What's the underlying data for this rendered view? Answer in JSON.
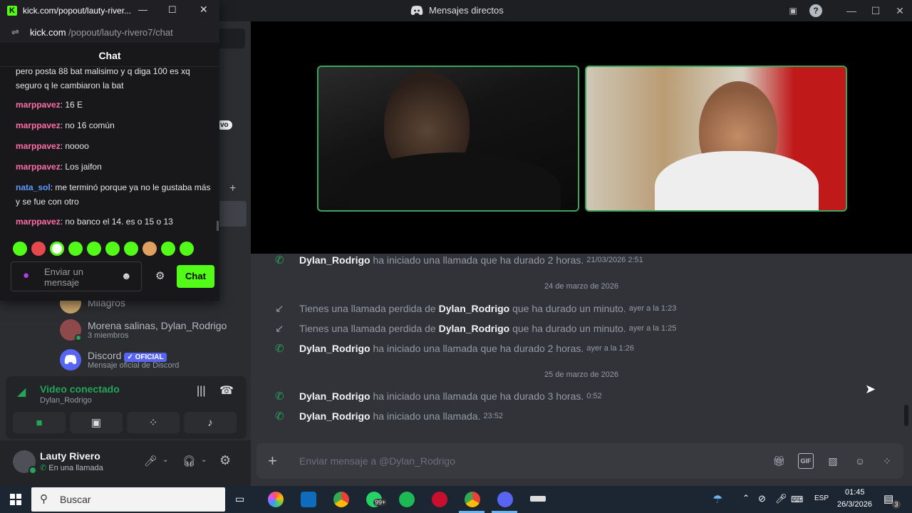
{
  "discord": {
    "window_title": "Mensajes directos",
    "win_minimize": "—",
    "win_maximize": "☐",
    "win_close": "✕",
    "dms": [
      {
        "name": "Milagros"
      },
      {
        "name": "Morena salinas, Dylan_Rodrigo",
        "sub": "3 miembros"
      },
      {
        "name": "Discord",
        "badge": "✓ OFICIAL",
        "sub": "Mensaje oficial de Discord"
      }
    ],
    "hidden_badge": "vo",
    "voice": {
      "status": "Video conectado",
      "channel": "Dylan_Rodrigo"
    },
    "user": {
      "name": "Lauty Rivero",
      "status": "En una llamada"
    },
    "messages": [
      {
        "type": "call",
        "user": "Dylan_Rodrigo",
        "text": "ha iniciado una llamada que ha durado 2 horas.",
        "time": "21/03/2026 2:51"
      },
      {
        "type": "date",
        "text": "24 de marzo de 2026"
      },
      {
        "type": "missed",
        "prefix": "Tienes una llamada perdida de",
        "user": "Dylan_Rodrigo",
        "text": "que ha durado un minuto.",
        "time": "ayer a la 1:23"
      },
      {
        "type": "missed",
        "prefix": "Tienes una llamada perdida de",
        "user": "Dylan_Rodrigo",
        "text": "que ha durado un minuto.",
        "time": "ayer a la 1:25"
      },
      {
        "type": "call",
        "user": "Dylan_Rodrigo",
        "text": "ha iniciado una llamada que ha durado 2 horas.",
        "time": "ayer a la 1:26"
      },
      {
        "type": "date",
        "text": "25 de marzo de 2026"
      },
      {
        "type": "call",
        "user": "Dylan_Rodrigo",
        "text": "ha iniciado una llamada que ha durado 3 horas.",
        "time": "0:52"
      },
      {
        "type": "call",
        "user": "Dylan_Rodrigo",
        "text": "ha iniciado una llamada.",
        "time": "23:52"
      }
    ],
    "composer_placeholder": "Enviar mensaje a @Dylan_Rodrigo"
  },
  "kick": {
    "window_title": "kick.com/popout/lauty-river...",
    "url_domain": "kick.com",
    "url_path": "/popout/lauty-rivero7/chat",
    "header": "Chat",
    "messages": [
      {
        "user": "",
        "text": "pero posta 88 bat malisimo y q diga 100 es xq seguro q le cambiaron la bat"
      },
      {
        "user": "marppavez",
        "text": "16 E"
      },
      {
        "user": "marppavez",
        "text": "no 16 común"
      },
      {
        "user": "marppavez",
        "text": "noooo"
      },
      {
        "user": "marppavez",
        "text": "Los jaifon"
      },
      {
        "user": "nata_sol",
        "text": "me terminó porque ya no le gustaba más y se fue con otro"
      },
      {
        "user": "marppavez",
        "text": "no banco el 14. es o 15 o 13"
      }
    ],
    "colors": {
      "marppavez": "#ff6ea8",
      "nata_sol": "#5b9bff",
      "accent": "#53fc18"
    },
    "input_placeholder": "Enviar un mensaje",
    "send_label": "Chat"
  },
  "taskbar": {
    "search_placeholder": "Buscar",
    "whatsapp_badge": "99+",
    "lang": "ESP",
    "time": "01:45",
    "date": "26/3/2026",
    "notif_count": "3"
  }
}
